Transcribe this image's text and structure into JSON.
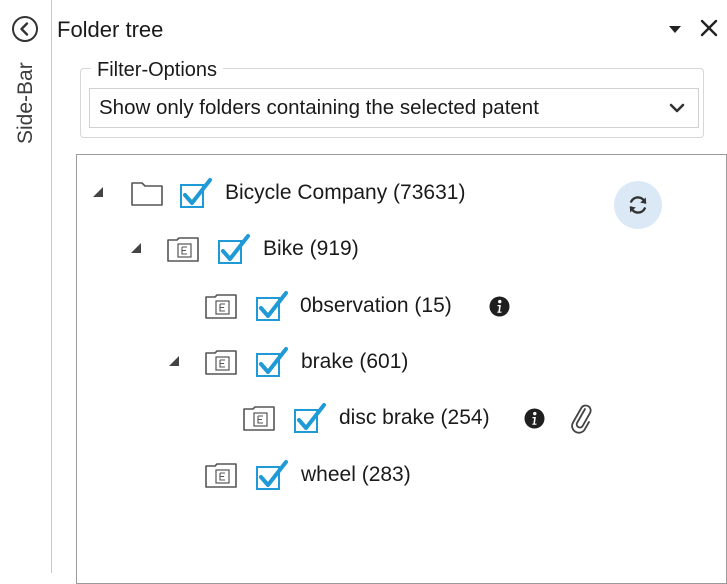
{
  "sidebar": {
    "label": "Side-Bar",
    "collapse_icon": "chevron-left-circle-icon"
  },
  "panel": {
    "title": "Folder tree",
    "dropdown_icon": "caret-down-icon",
    "close_icon": "close-icon"
  },
  "filter": {
    "legend": "Filter-Options",
    "selected": "Show only folders containing the selected patent",
    "chevron_icon": "chevron-down-icon"
  },
  "tree": {
    "refresh_icon": "refresh-icon",
    "check_color": "#1f9ad6",
    "nodes": [
      {
        "label": "Bicycle Company (73631)",
        "expanded": true,
        "checked": true,
        "folder": "plain-folder-icon"
      },
      {
        "label": "Bike (919)",
        "expanded": true,
        "checked": true,
        "folder": "tagged-folder-icon"
      },
      {
        "label": "0bservation (15)",
        "checked": true,
        "folder": "tagged-folder-icon",
        "info": true
      },
      {
        "label": "brake (601)",
        "expanded": true,
        "checked": true,
        "folder": "tagged-folder-icon"
      },
      {
        "label": "disc brake (254)",
        "checked": true,
        "folder": "tagged-folder-icon",
        "info": true,
        "attachment": true
      },
      {
        "label": "wheel (283)",
        "checked": true,
        "folder": "tagged-folder-icon"
      }
    ]
  }
}
